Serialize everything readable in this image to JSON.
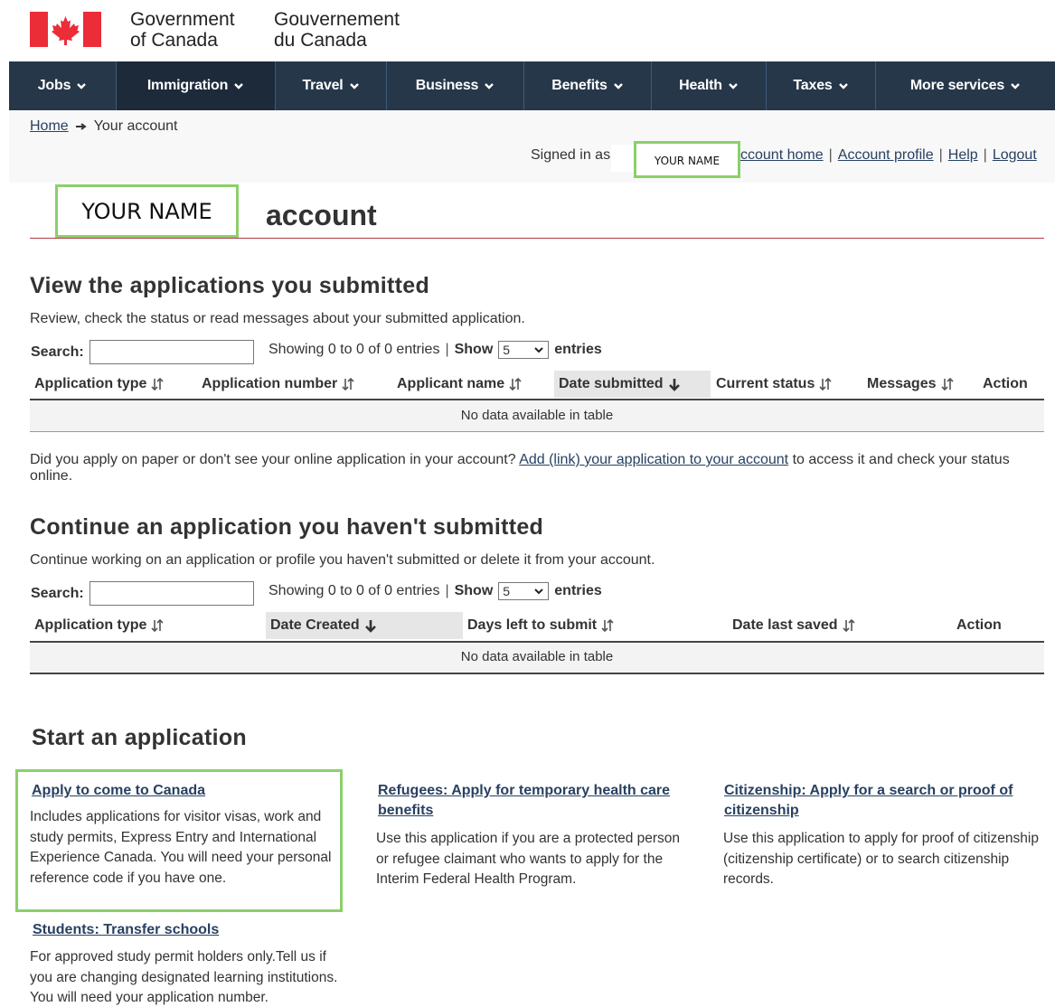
{
  "header": {
    "signature_en": [
      "Government",
      "of Canada"
    ],
    "signature_fr": [
      "Gouvernement",
      "du Canada"
    ],
    "flag_colors": {
      "red": "#eb2d37",
      "white": "#ffffff"
    }
  },
  "menu": {
    "items": [
      {
        "label": "Jobs"
      },
      {
        "label": "Immigration"
      },
      {
        "label": "Travel"
      },
      {
        "label": "Business"
      },
      {
        "label": "Benefits"
      },
      {
        "label": "Health"
      },
      {
        "label": "Taxes"
      },
      {
        "label": "More services"
      }
    ],
    "active_index": 1,
    "bar_color": "#26374a"
  },
  "breadcrumb": {
    "home": "Home",
    "current": "Your account"
  },
  "account_bar": {
    "signed_in_label": "Signed in as",
    "user_name": "YOUR NAME",
    "links": [
      "ccount home",
      "Account profile",
      "Help",
      "Logout"
    ],
    "separator": "|"
  },
  "page_title": {
    "name": "YOUR NAME",
    "rest": "account"
  },
  "submitted": {
    "heading": "View the applications you submitted",
    "description": "Review, check the status or read messages about your submitted application.",
    "search_label": "Search:",
    "showing_text": "Showing 0 to 0 of 0 entries",
    "show_label": "Show",
    "page_size": "5",
    "entries_label": "entries",
    "columns": [
      "Application type",
      "Application number",
      "Applicant name",
      "Date submitted",
      "Current status",
      "Messages",
      "Action"
    ],
    "empty_text": "No data available in table",
    "paper_note_before": "Did you apply on paper or don't see your online application in your account?",
    "paper_note_link": "Add (link) your application to your account",
    "paper_note_after": "to access it and check your status online."
  },
  "unsubmitted": {
    "heading": "Continue an application you haven't submitted",
    "description": "Continue working on an application or profile you haven't submitted or delete it from your account.",
    "search_label": "Search:",
    "showing_text": "Showing 0 to 0 of 0 entries",
    "show_label": "Show",
    "page_size": "5",
    "entries_label": "entries",
    "columns": [
      "Application type",
      "Date Created",
      "Days left to submit",
      "Date last saved",
      "Action"
    ],
    "empty_text": "No data available in table"
  },
  "start": {
    "heading": "Start an application",
    "cards": [
      {
        "title": "Apply to come to Canada",
        "text": [
          "Includes applications for visitor visas, work and",
          "study permits, Express Entry and International",
          "Experience Canada. You will need your personal",
          "reference code if you have one."
        ]
      },
      {
        "title": [
          "Refugees: Apply for temporary health care",
          "benefits"
        ],
        "text": [
          "Use this application if you are a protected person",
          "or refugee claimant who wants to apply for the",
          "Interim Federal Health Program."
        ]
      },
      {
        "title": [
          "Citizenship: Apply for a search or proof of",
          "citizenship"
        ],
        "text": [
          "Use this application to apply for proof of citizenship",
          "(citizenship certificate) or to search citizenship",
          "records."
        ]
      },
      {
        "title": "Students: Transfer schools",
        "text": [
          "For approved study permit holders only.Tell us if",
          "you are changing designated learning institutions.",
          "You will need your application number."
        ]
      }
    ]
  },
  "colors": {
    "link": "#284162",
    "highlight_border": "#8bd06a",
    "title_rule": "#af3c43"
  }
}
